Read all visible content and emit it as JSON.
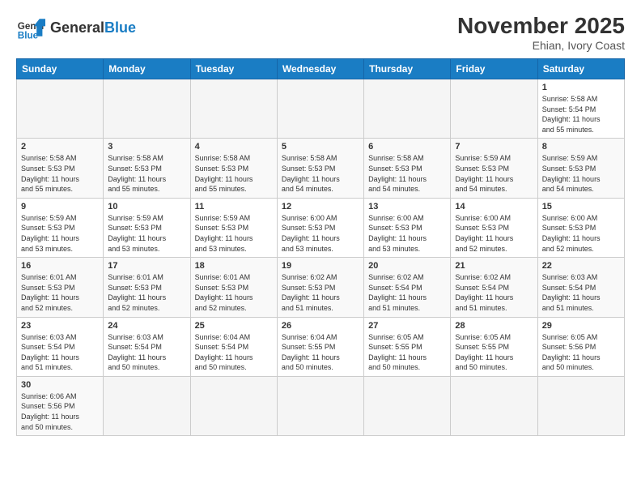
{
  "header": {
    "logo_general": "General",
    "logo_blue": "Blue",
    "month_title": "November 2025",
    "location": "Ehian, Ivory Coast"
  },
  "weekdays": [
    "Sunday",
    "Monday",
    "Tuesday",
    "Wednesday",
    "Thursday",
    "Friday",
    "Saturday"
  ],
  "weeks": [
    [
      {
        "day": "",
        "info": ""
      },
      {
        "day": "",
        "info": ""
      },
      {
        "day": "",
        "info": ""
      },
      {
        "day": "",
        "info": ""
      },
      {
        "day": "",
        "info": ""
      },
      {
        "day": "",
        "info": ""
      },
      {
        "day": "1",
        "info": "Sunrise: 5:58 AM\nSunset: 5:54 PM\nDaylight: 11 hours\nand 55 minutes."
      }
    ],
    [
      {
        "day": "2",
        "info": "Sunrise: 5:58 AM\nSunset: 5:53 PM\nDaylight: 11 hours\nand 55 minutes."
      },
      {
        "day": "3",
        "info": "Sunrise: 5:58 AM\nSunset: 5:53 PM\nDaylight: 11 hours\nand 55 minutes."
      },
      {
        "day": "4",
        "info": "Sunrise: 5:58 AM\nSunset: 5:53 PM\nDaylight: 11 hours\nand 55 minutes."
      },
      {
        "day": "5",
        "info": "Sunrise: 5:58 AM\nSunset: 5:53 PM\nDaylight: 11 hours\nand 54 minutes."
      },
      {
        "day": "6",
        "info": "Sunrise: 5:58 AM\nSunset: 5:53 PM\nDaylight: 11 hours\nand 54 minutes."
      },
      {
        "day": "7",
        "info": "Sunrise: 5:59 AM\nSunset: 5:53 PM\nDaylight: 11 hours\nand 54 minutes."
      },
      {
        "day": "8",
        "info": "Sunrise: 5:59 AM\nSunset: 5:53 PM\nDaylight: 11 hours\nand 54 minutes."
      }
    ],
    [
      {
        "day": "9",
        "info": "Sunrise: 5:59 AM\nSunset: 5:53 PM\nDaylight: 11 hours\nand 53 minutes."
      },
      {
        "day": "10",
        "info": "Sunrise: 5:59 AM\nSunset: 5:53 PM\nDaylight: 11 hours\nand 53 minutes."
      },
      {
        "day": "11",
        "info": "Sunrise: 5:59 AM\nSunset: 5:53 PM\nDaylight: 11 hours\nand 53 minutes."
      },
      {
        "day": "12",
        "info": "Sunrise: 6:00 AM\nSunset: 5:53 PM\nDaylight: 11 hours\nand 53 minutes."
      },
      {
        "day": "13",
        "info": "Sunrise: 6:00 AM\nSunset: 5:53 PM\nDaylight: 11 hours\nand 53 minutes."
      },
      {
        "day": "14",
        "info": "Sunrise: 6:00 AM\nSunset: 5:53 PM\nDaylight: 11 hours\nand 52 minutes."
      },
      {
        "day": "15",
        "info": "Sunrise: 6:00 AM\nSunset: 5:53 PM\nDaylight: 11 hours\nand 52 minutes."
      }
    ],
    [
      {
        "day": "16",
        "info": "Sunrise: 6:01 AM\nSunset: 5:53 PM\nDaylight: 11 hours\nand 52 minutes."
      },
      {
        "day": "17",
        "info": "Sunrise: 6:01 AM\nSunset: 5:53 PM\nDaylight: 11 hours\nand 52 minutes."
      },
      {
        "day": "18",
        "info": "Sunrise: 6:01 AM\nSunset: 5:53 PM\nDaylight: 11 hours\nand 52 minutes."
      },
      {
        "day": "19",
        "info": "Sunrise: 6:02 AM\nSunset: 5:53 PM\nDaylight: 11 hours\nand 51 minutes."
      },
      {
        "day": "20",
        "info": "Sunrise: 6:02 AM\nSunset: 5:54 PM\nDaylight: 11 hours\nand 51 minutes."
      },
      {
        "day": "21",
        "info": "Sunrise: 6:02 AM\nSunset: 5:54 PM\nDaylight: 11 hours\nand 51 minutes."
      },
      {
        "day": "22",
        "info": "Sunrise: 6:03 AM\nSunset: 5:54 PM\nDaylight: 11 hours\nand 51 minutes."
      }
    ],
    [
      {
        "day": "23",
        "info": "Sunrise: 6:03 AM\nSunset: 5:54 PM\nDaylight: 11 hours\nand 51 minutes."
      },
      {
        "day": "24",
        "info": "Sunrise: 6:03 AM\nSunset: 5:54 PM\nDaylight: 11 hours\nand 50 minutes."
      },
      {
        "day": "25",
        "info": "Sunrise: 6:04 AM\nSunset: 5:54 PM\nDaylight: 11 hours\nand 50 minutes."
      },
      {
        "day": "26",
        "info": "Sunrise: 6:04 AM\nSunset: 5:55 PM\nDaylight: 11 hours\nand 50 minutes."
      },
      {
        "day": "27",
        "info": "Sunrise: 6:05 AM\nSunset: 5:55 PM\nDaylight: 11 hours\nand 50 minutes."
      },
      {
        "day": "28",
        "info": "Sunrise: 6:05 AM\nSunset: 5:55 PM\nDaylight: 11 hours\nand 50 minutes."
      },
      {
        "day": "29",
        "info": "Sunrise: 6:05 AM\nSunset: 5:56 PM\nDaylight: 11 hours\nand 50 minutes."
      }
    ],
    [
      {
        "day": "30",
        "info": "Sunrise: 6:06 AM\nSunset: 5:56 PM\nDaylight: 11 hours\nand 50 minutes."
      },
      {
        "day": "",
        "info": ""
      },
      {
        "day": "",
        "info": ""
      },
      {
        "day": "",
        "info": ""
      },
      {
        "day": "",
        "info": ""
      },
      {
        "day": "",
        "info": ""
      },
      {
        "day": "",
        "info": ""
      }
    ]
  ]
}
